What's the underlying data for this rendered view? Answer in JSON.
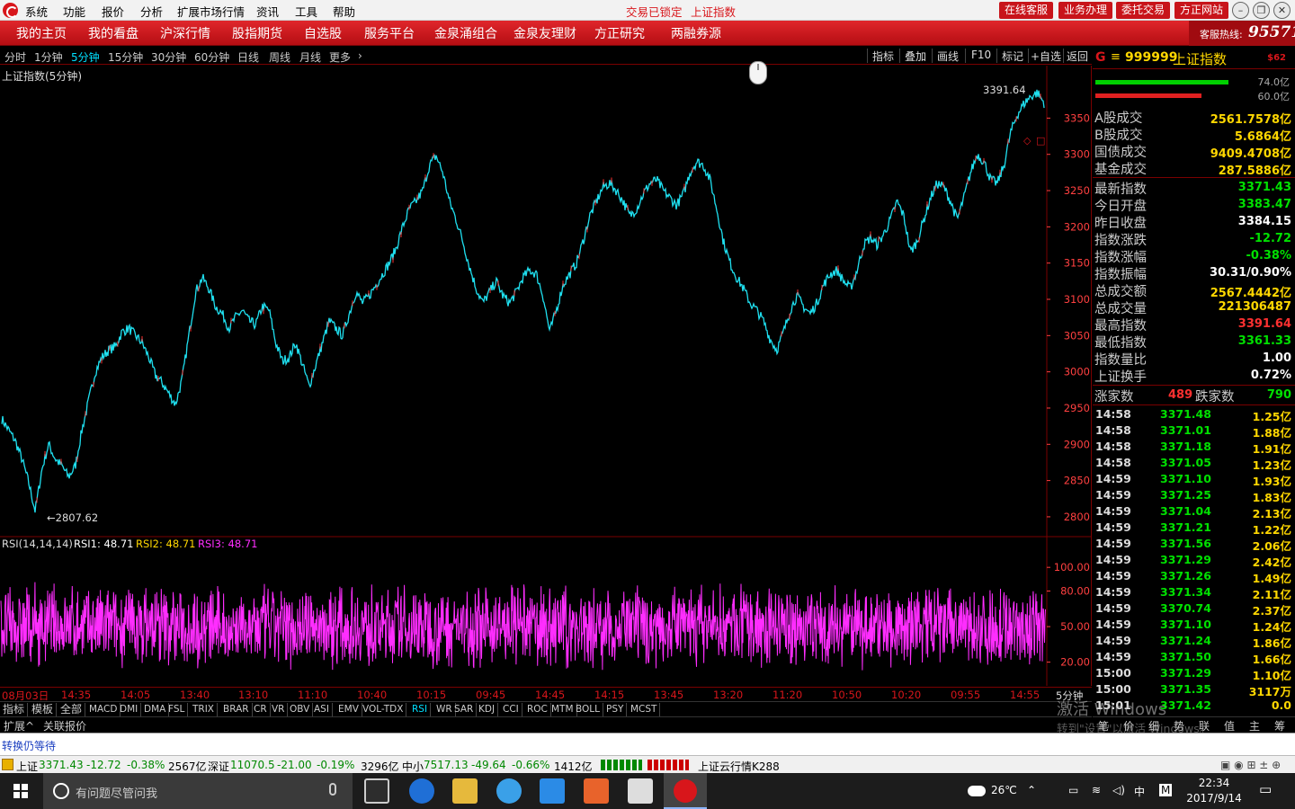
{
  "menu": [
    "系统",
    "功能",
    "报价",
    "分析",
    "扩展市场行情",
    "资讯",
    "工具",
    "帮助"
  ],
  "title_status": [
    "交易已锁定",
    "上证指数"
  ],
  "title_buttons": [
    "在线客服",
    "业务办理",
    "委托交易",
    "方正网站"
  ],
  "nav": [
    "我的主页",
    "我的看盘",
    "沪深行情",
    "股指期货",
    "自选股",
    "服务平台",
    "金泉涌组合",
    "金泉友理财",
    "方正研究",
    "两融券源"
  ],
  "hotline": {
    "label": "客服热线:",
    "number": "95571"
  },
  "periods": [
    "分时",
    "1分钟",
    "5分钟",
    "15分钟",
    "30分钟",
    "60分钟",
    "日线",
    "周线",
    "月线",
    "更多"
  ],
  "active_period": "5分钟",
  "tools": [
    "指标",
    "叠加",
    "画线",
    "F10",
    "标记",
    "+自选",
    "返回"
  ],
  "chart": {
    "title": "上证指数(5分钟)",
    "rsi_label": "RSI(14,14,14)",
    "rsi1": "RSI1: 48.71",
    "rsi2": "RSI2: 48.71",
    "rsi3": "RSI3: 48.71",
    "period_tag": "5分钟",
    "colors": {
      "price": "#1fe0f0",
      "rsi": "#ff2dff",
      "up": "#ff3030",
      "axis": "#ff4040"
    }
  },
  "chart_data": {
    "type": "line",
    "series": [
      {
        "values": [
          2935,
          2920,
          2905,
          2880,
          2848,
          2808,
          2865,
          2900,
          2880,
          2870,
          2855,
          2870,
          2920,
          2960,
          3000,
          3020,
          3030,
          3035,
          3055,
          3060,
          3050,
          3040,
          3020,
          2995,
          2985,
          2970,
          2955,
          2990,
          3050,
          3110,
          3130,
          3115,
          3090,
          3080,
          3060,
          3075,
          3085,
          3070,
          3065,
          3090,
          3085,
          3040,
          3015,
          3020,
          3040,
          3010,
          2980,
          3010,
          3040,
          3070,
          3060,
          3050,
          3080,
          3110,
          3095,
          3105,
          3120,
          3135,
          3150,
          3170,
          3200,
          3225,
          3235,
          3250,
          3285,
          3298,
          3275,
          3235,
          3210,
          3180,
          3145,
          3115,
          3095,
          3110,
          3125,
          3105,
          3095,
          3110,
          3130,
          3140,
          3135,
          3105,
          3055,
          3085,
          3120,
          3135,
          3150,
          3180,
          3215,
          3235,
          3255,
          3260,
          3250,
          3235,
          3215,
          3225,
          3245,
          3260,
          3265,
          3250,
          3240,
          3230,
          3245,
          3275,
          3290,
          3285,
          3265,
          3225,
          3180,
          3150,
          3130,
          3115,
          3095,
          3085,
          3070,
          3045,
          3030,
          3055,
          3085,
          3105,
          3090,
          3080,
          3095,
          3120,
          3135,
          3140,
          3125,
          3115,
          3140,
          3175,
          3185,
          3175,
          3190,
          3210,
          3235,
          3215,
          3165,
          3180,
          3210,
          3240,
          3260,
          3255,
          3235,
          3210,
          3240,
          3275,
          3300,
          3290,
          3265,
          3260,
          3285,
          3330,
          3355,
          3370,
          3380,
          3385,
          3371
        ]
      }
    ],
    "ylim": [
      2790,
      3410
    ],
    "yticks": [
      3350,
      3300,
      3250,
      3200,
      3150,
      3100,
      3050,
      3000,
      2950,
      2900,
      2850,
      2800
    ],
    "annotations": {
      "high": "3391.64",
      "low": "2807.62"
    },
    "x_labels": [
      "08月03日",
      "14:35",
      "14:05",
      "13:40",
      "13:10",
      "11:10",
      "10:40",
      "10:15",
      "09:45",
      "14:45",
      "14:15",
      "13:45",
      "13:20",
      "11:20",
      "10:50",
      "10:20",
      "09:55",
      "14:55"
    ],
    "rsi": {
      "ylim": [
        0,
        110
      ],
      "yticks": [
        "100.00",
        "80.00",
        "50.00",
        "20.00"
      ],
      "center": 50
    }
  },
  "indicator_tabs": [
    "指标",
    "模板",
    "全部",
    "MACD",
    "DMI",
    "DMA",
    "FSL",
    "TRIX",
    "BRAR",
    "CR",
    "VR",
    "OBV",
    "ASI",
    "EMV",
    "VOL-TDX",
    "RSI",
    "WR",
    "SAR",
    "KDJ",
    "CCI",
    "ROC",
    "MTM",
    "BOLL",
    "PSY",
    "MCST"
  ],
  "active_indicator": "RSI",
  "ext_bar": [
    "扩展^",
    "关联报价"
  ],
  "panel": {
    "g": "G",
    "eq": "≡",
    "code": "999999",
    "name": "上证指数",
    "tag": "$62",
    "bar_green_pct": "74.0亿",
    "bar_red_pct": "60.0亿",
    "rows1": [
      {
        "label": "A股成交",
        "value": "2561.7578亿",
        "color": "#ffd700"
      },
      {
        "label": "B股成交",
        "value": "5.6864亿",
        "color": "#ffd700"
      },
      {
        "label": "国债成交",
        "value": "9409.4708亿",
        "color": "#ffd700"
      },
      {
        "label": "基金成交",
        "value": "287.5886亿",
        "color": "#ffd700"
      }
    ],
    "rows2": [
      {
        "label": "最新指数",
        "value": "3371.43",
        "color": "#00e000"
      },
      {
        "label": "今日开盘",
        "value": "3383.47",
        "color": "#00e000"
      },
      {
        "label": "昨日收盘",
        "value": "3384.15",
        "color": "#ffffff"
      },
      {
        "label": "指数涨跌",
        "value": "-12.72",
        "color": "#00e000"
      },
      {
        "label": "指数涨幅",
        "value": "-0.38%",
        "color": "#00e000"
      },
      {
        "label": "指数振幅",
        "value": "30.31/0.90%",
        "color": "#ffffff"
      },
      {
        "label": "总成交额",
        "value": "2567.4442亿",
        "color": "#ffd700"
      },
      {
        "label": "总成交量",
        "value": "221306487",
        "color": "#ffd700"
      },
      {
        "label": "最高指数",
        "value": "3391.64",
        "color": "#ff3030"
      },
      {
        "label": "最低指数",
        "value": "3361.33",
        "color": "#00e000"
      },
      {
        "label": "指数量比",
        "value": "1.00",
        "color": "#ffffff"
      },
      {
        "label": "上证换手",
        "value": "0.72%",
        "color": "#ffffff"
      }
    ],
    "up_label": "涨家数",
    "up_value": "489",
    "down_label": "跌家数",
    "down_value": "790",
    "ticks": [
      {
        "t": "14:58",
        "p": "3371.48",
        "v": "1.25亿"
      },
      {
        "t": "14:58",
        "p": "3371.01",
        "v": "1.88亿"
      },
      {
        "t": "14:58",
        "p": "3371.18",
        "v": "1.91亿"
      },
      {
        "t": "14:58",
        "p": "3371.05",
        "v": "1.23亿"
      },
      {
        "t": "14:59",
        "p": "3371.10",
        "v": "1.93亿"
      },
      {
        "t": "14:59",
        "p": "3371.25",
        "v": "1.83亿"
      },
      {
        "t": "14:59",
        "p": "3371.04",
        "v": "2.13亿"
      },
      {
        "t": "14:59",
        "p": "3371.21",
        "v": "1.22亿"
      },
      {
        "t": "14:59",
        "p": "3371.56",
        "v": "2.06亿"
      },
      {
        "t": "14:59",
        "p": "3371.29",
        "v": "2.42亿"
      },
      {
        "t": "14:59",
        "p": "3371.26",
        "v": "1.49亿"
      },
      {
        "t": "14:59",
        "p": "3371.34",
        "v": "2.11亿"
      },
      {
        "t": "14:59",
        "p": "3370.74",
        "v": "2.37亿"
      },
      {
        "t": "14:59",
        "p": "3371.10",
        "v": "1.24亿"
      },
      {
        "t": "14:59",
        "p": "3371.24",
        "v": "1.86亿"
      },
      {
        "t": "14:59",
        "p": "3371.50",
        "v": "1.66亿"
      },
      {
        "t": "15:00",
        "p": "3371.29",
        "v": "1.10亿"
      },
      {
        "t": "15:00",
        "p": "3371.35",
        "v": "3117万"
      },
      {
        "t": "15:01",
        "p": "3371.42",
        "v": "0.0"
      }
    ],
    "bottom_tabs": [
      "笔",
      "价",
      "细",
      "势",
      "联",
      "值",
      "主",
      "筹"
    ]
  },
  "watermark": {
    "line1": "激活 Windows",
    "line2": "转到\"设置\"以激活 Windows。"
  },
  "status_msg": "转换仍等待",
  "ticker": {
    "sh_name": "上证",
    "sh_price": "3371.43",
    "sh_chg": "-12.72",
    "sh_pct": "-0.38%",
    "sh_amt": "2567亿",
    "sz_name": "深证",
    "sz_price": "11070.5",
    "sz_chg": "-21.00",
    "sz_pct": "-0.19%",
    "sz_amt": "3296亿",
    "zx_name": "中小",
    "zx_price": "7517.13",
    "zx_chg": "-49.64",
    "zx_pct": "-0.66%",
    "zx_amt": "1412亿",
    "cloud": "上证云行情K288"
  },
  "taskbar": {
    "search_placeholder": "有问题尽管问我",
    "weather": "26℃",
    "ime": "中",
    "m": "M",
    "time": "22:34",
    "date": "2017/9/14"
  }
}
